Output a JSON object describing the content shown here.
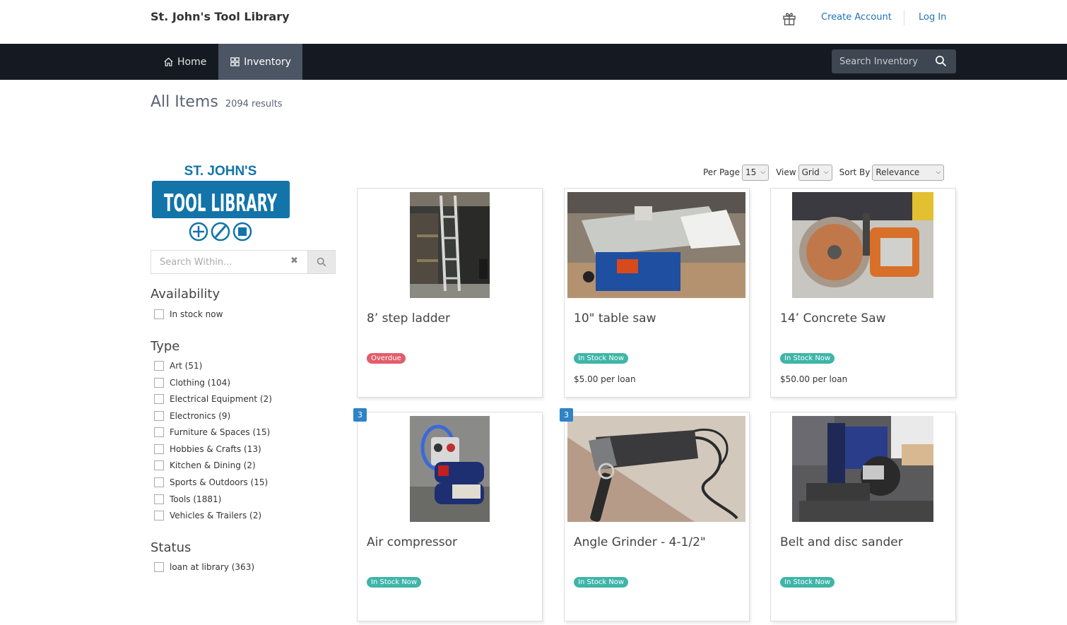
{
  "header": {
    "site_name": "St. John's Tool Library",
    "create_account": "Create Account",
    "log_in": "Log In"
  },
  "nav": {
    "home": "Home",
    "inventory": "Inventory",
    "search_placeholder": "Search Inventory"
  },
  "page": {
    "title": "All Items",
    "count": "2094 results"
  },
  "logo": {
    "line1": "ST. JOHN'S",
    "line2": "TOOL LIBRARY"
  },
  "sidebar": {
    "search_placeholder": "Search Within...",
    "availability": {
      "heading": "Availability",
      "items": [
        "In stock now"
      ]
    },
    "type": {
      "heading": "Type",
      "items": [
        "Art (51)",
        "Clothing (104)",
        "Electrical Equipment (2)",
        "Electronics (9)",
        "Furniture & Spaces (15)",
        "Hobbies & Crafts (13)",
        "Kitchen & Dining (2)",
        "Sports & Outdoors (15)",
        "Tools (1881)",
        "Vehicles & Trailers (2)"
      ]
    },
    "status": {
      "heading": "Status",
      "items": [
        "loan at library (363)"
      ]
    }
  },
  "controls": {
    "per_page_label": "Per Page",
    "per_page_value": "15",
    "view_label": "View",
    "view_value": "Grid",
    "sort_label": "Sort By",
    "sort_value": "Relevance"
  },
  "items": [
    {
      "title": "8’ step ladder",
      "status": "Overdue",
      "price": "",
      "count": ""
    },
    {
      "title": "10\" table saw",
      "status": "In Stock Now",
      "price": "$5.00 per loan",
      "count": ""
    },
    {
      "title": "14’ Concrete Saw",
      "status": "In Stock Now",
      "price": "$50.00 per loan",
      "count": ""
    },
    {
      "title": "Air compressor",
      "status": "In Stock Now",
      "price": "",
      "count": "3"
    },
    {
      "title": "Angle Grinder - 4-1/2\"",
      "status": "In Stock Now",
      "price": "",
      "count": "3"
    },
    {
      "title": "Belt and disc sander",
      "status": "In Stock Now",
      "price": "",
      "count": ""
    }
  ],
  "colors": {
    "navbar": "#151a22",
    "nav_active": "#4b5563",
    "link": "#1f73b7",
    "in_stock": "#3fb5a8",
    "overdue": "#e35d6a",
    "logo_blue": "#1274a8"
  }
}
